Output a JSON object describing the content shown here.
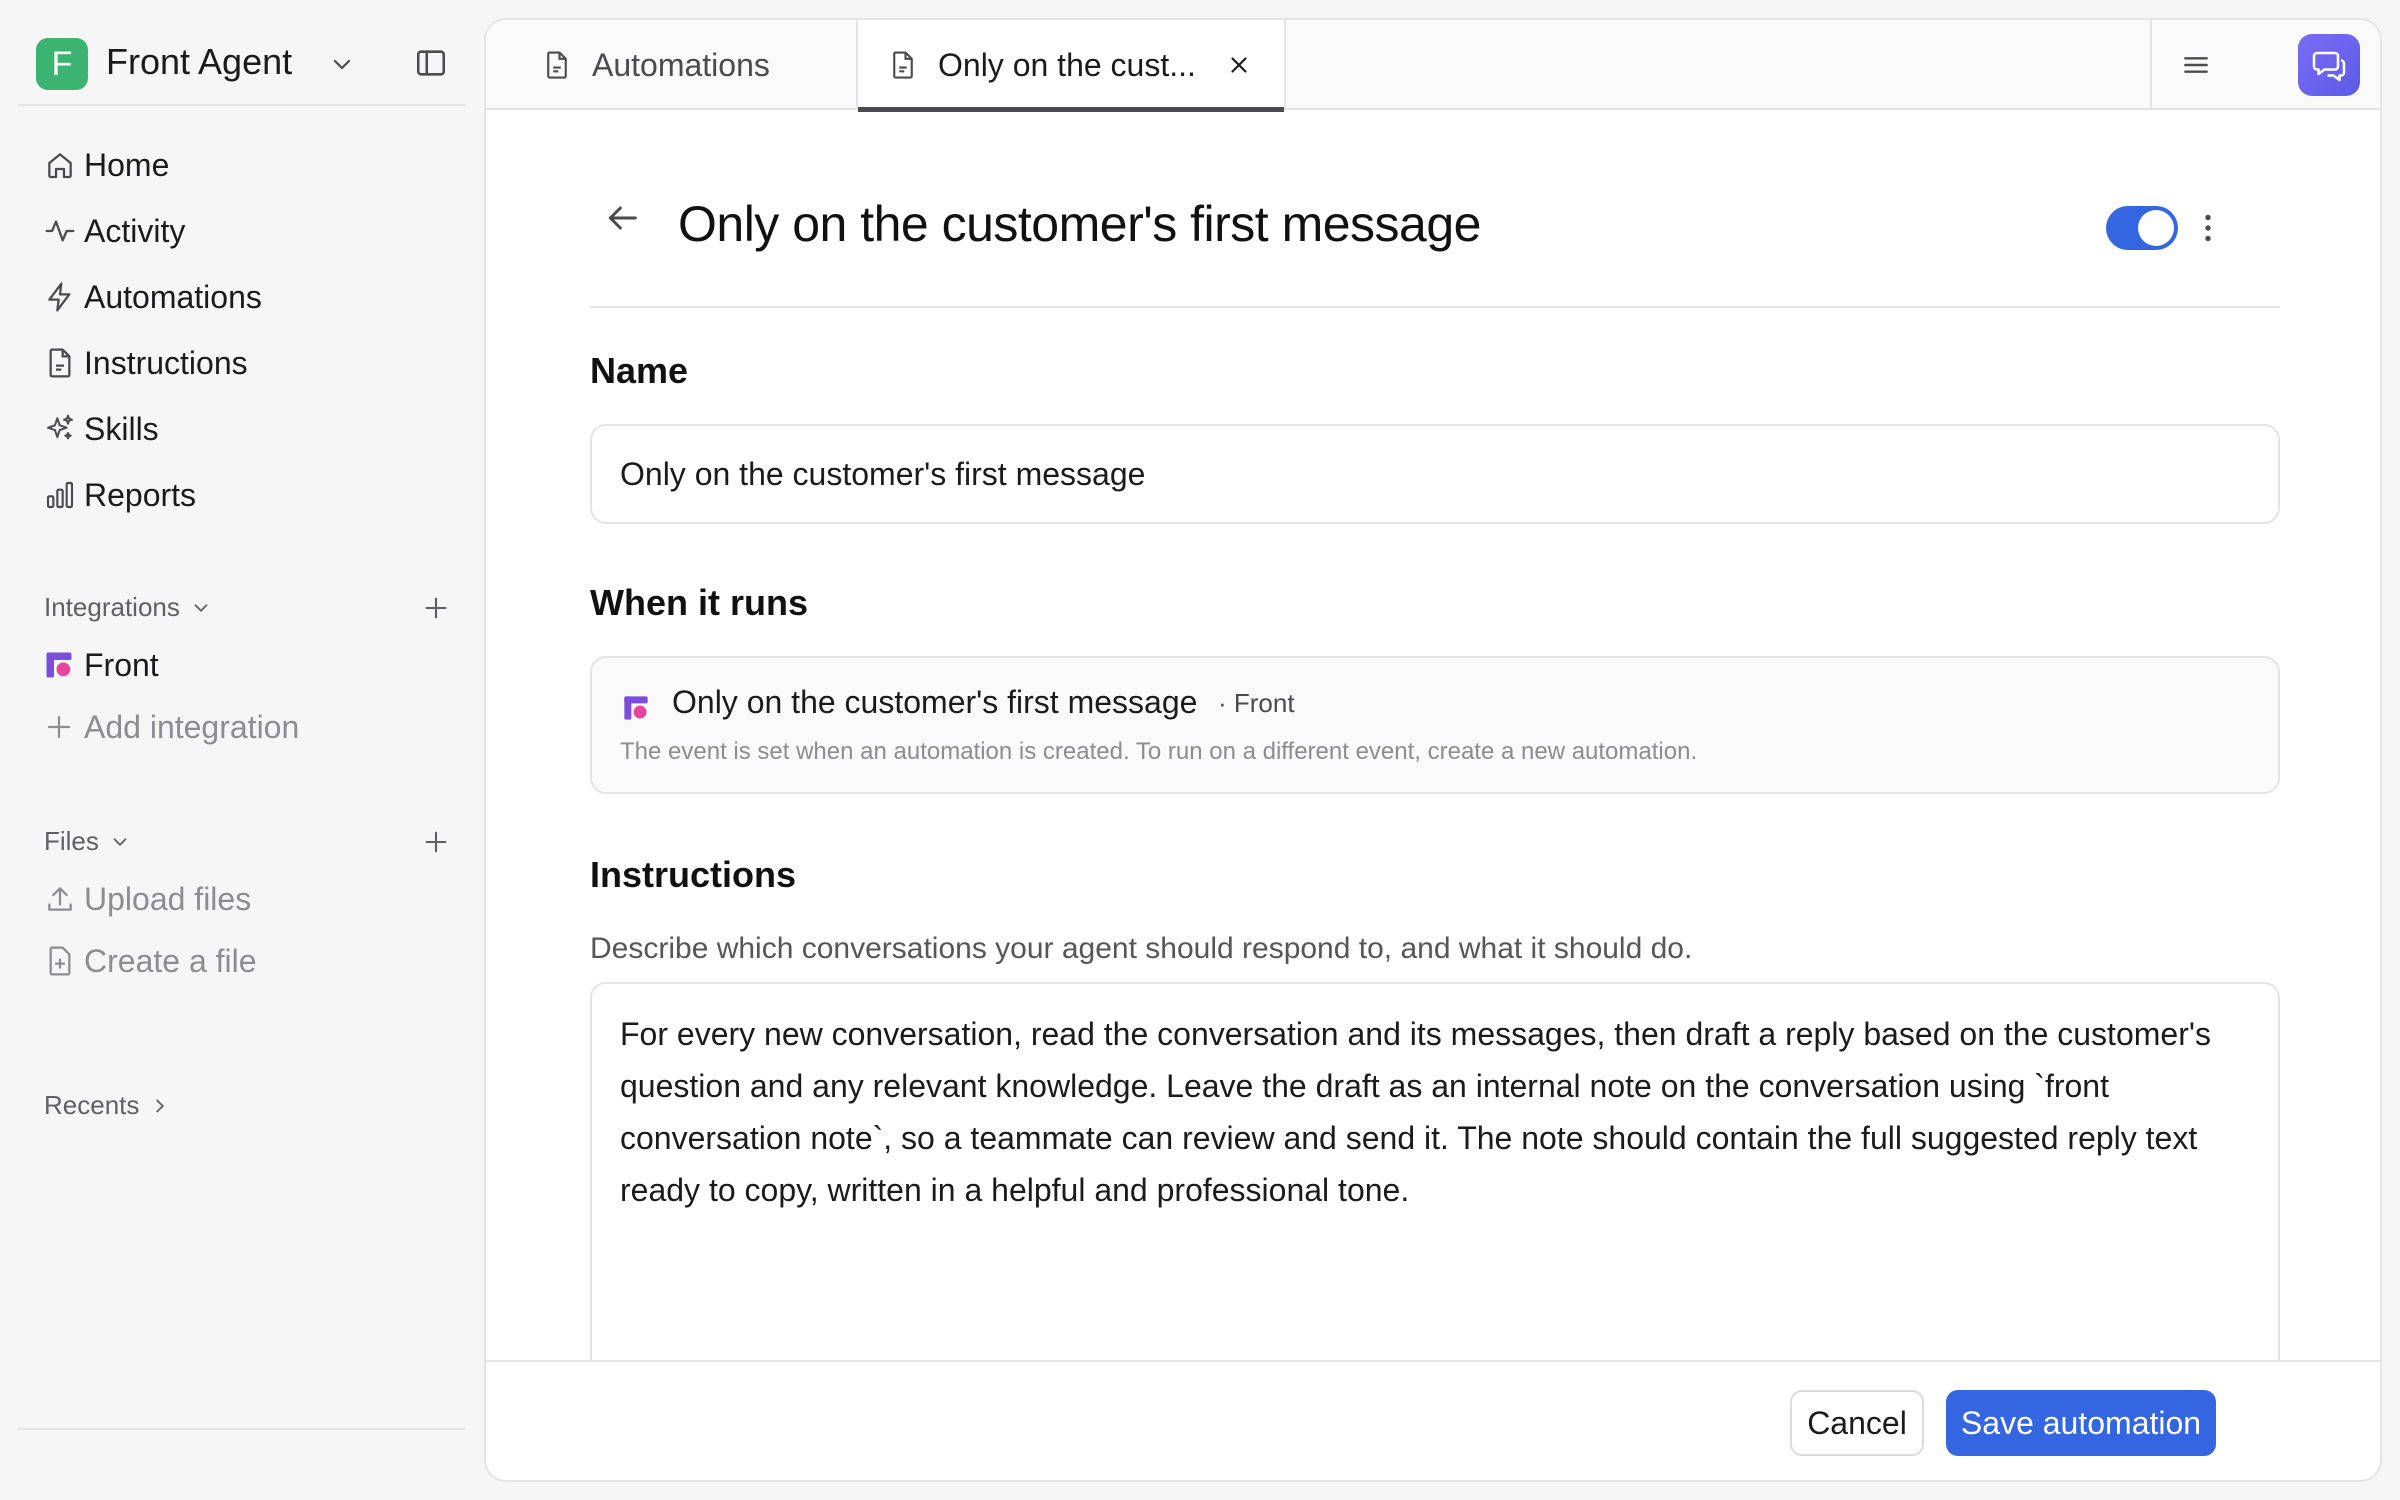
{
  "workspace": {
    "initial": "F",
    "name": "Front Agent",
    "logo_color": "#3cb371"
  },
  "sidebar": {
    "items": [
      {
        "label": "Home",
        "icon": "home-icon"
      },
      {
        "label": "Activity",
        "icon": "activity-icon"
      },
      {
        "label": "Automations",
        "icon": "lightning-icon"
      },
      {
        "label": "Instructions",
        "icon": "document-icon"
      },
      {
        "label": "Skills",
        "icon": "sparkle-icon"
      },
      {
        "label": "Reports",
        "icon": "bar-chart-icon"
      }
    ],
    "integrations": {
      "label": "Integrations",
      "items": [
        {
          "label": "Front",
          "icon": "front-logo-icon"
        }
      ],
      "add_label": "Add integration"
    },
    "files": {
      "label": "Files",
      "upload_label": "Upload files",
      "create_label": "Create a file"
    },
    "recents_label": "Recents"
  },
  "tabs": [
    {
      "label": "Automations",
      "active": false
    },
    {
      "label": "Only on the cust...",
      "active": true
    }
  ],
  "page": {
    "title": "Only on the customer's first message",
    "enabled": true,
    "name_label": "Name",
    "name_value": "Only on the customer's first message",
    "when_label": "When it runs",
    "event": {
      "title": "Only on the customer's first message",
      "source": "· Front",
      "description": "The event is set when an automation is created. To run on a different event, create a new automation."
    },
    "instructions_label": "Instructions",
    "instructions_description": "Describe which conversations your agent should respond to, and what it should do.",
    "instructions_value": "For every new conversation, read the conversation and its messages, then draft a reply based on the customer's question and any relevant knowledge. Leave the draft as an internal note on the conversation using `front conversation note`, so a teammate can review and send it. The note should contain the full suggested reply text ready to copy, written in a helpful and professional tone."
  },
  "footer": {
    "cancel_label": "Cancel",
    "save_label": "Save automation"
  },
  "colors": {
    "accent": "#3366e0",
    "front_brand": "#7c4ddb"
  }
}
